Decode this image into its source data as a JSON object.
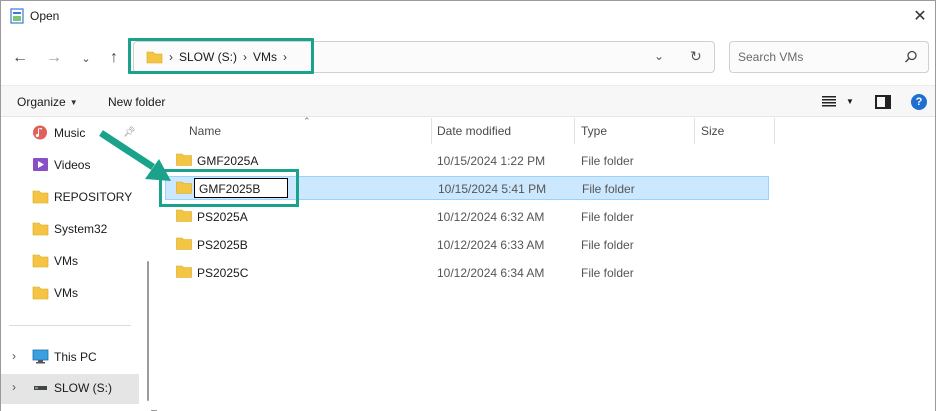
{
  "window": {
    "title": "Open",
    "close_icon": "close-icon"
  },
  "nav": {
    "back_icon": "arrow-left-icon",
    "forward_icon": "arrow-right-icon",
    "recent_icon": "chevron-down-icon",
    "up_icon": "arrow-up-icon",
    "breadcrumb": [
      "SLOW (S:)",
      "VMs"
    ],
    "refresh_icon": "refresh-icon"
  },
  "search": {
    "placeholder": "Search VMs",
    "value": ""
  },
  "toolbar": {
    "organize_label": "Organize",
    "new_folder_label": "New folder"
  },
  "sidebar": {
    "items": [
      {
        "label": "Music",
        "icon": "music-icon"
      },
      {
        "label": "Videos",
        "icon": "videos-icon"
      },
      {
        "label": "REPOSITORY",
        "icon": "folder-icon"
      },
      {
        "label": "System32",
        "icon": "folder-icon"
      },
      {
        "label": "VMs",
        "icon": "folder-icon"
      },
      {
        "label": "VMs",
        "icon": "folder-icon"
      },
      {
        "label": "This PC",
        "icon": "computer-icon"
      },
      {
        "label": "SLOW (S:)",
        "icon": "drive-icon"
      }
    ]
  },
  "columns": {
    "name": "Name",
    "date": "Date modified",
    "type": "Type",
    "size": "Size"
  },
  "files": [
    {
      "name": "GMF2025A",
      "date": "10/15/2024 1:22 PM",
      "type": "File folder"
    },
    {
      "name": "GMF2025B",
      "date": "10/15/2024 5:41 PM",
      "type": "File folder"
    },
    {
      "name": "PS2025A",
      "date": "10/12/2024 6:32 AM",
      "type": "File folder"
    },
    {
      "name": "PS2025B",
      "date": "10/12/2024 6:33 AM",
      "type": "File folder"
    },
    {
      "name": "PS2025C",
      "date": "10/12/2024 6:34 AM",
      "type": "File folder"
    }
  ],
  "colors": {
    "annotation": "#1aa38a",
    "selection": "#cce8ff",
    "folder": "#f4c542"
  }
}
